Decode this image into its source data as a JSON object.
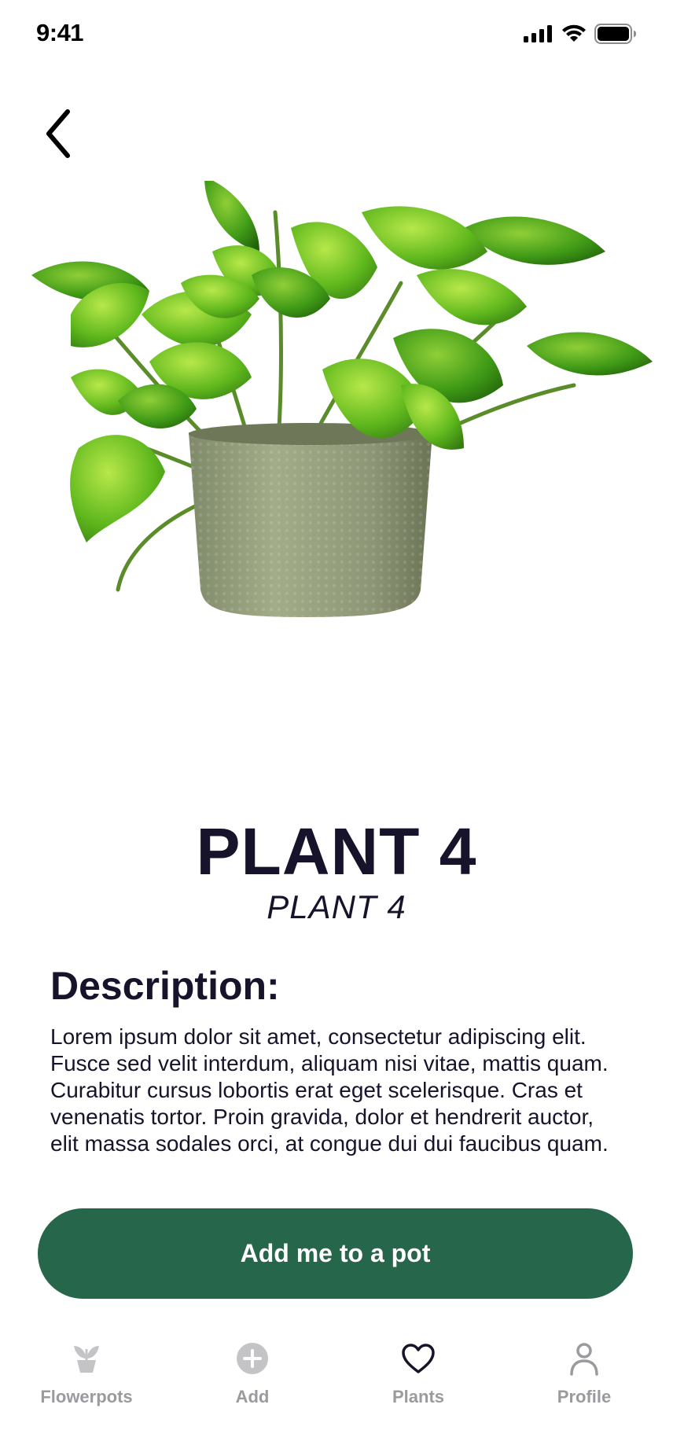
{
  "status_bar": {
    "time": "9:41"
  },
  "header": {
    "back_icon": "chevron-left-icon"
  },
  "plant": {
    "title": "PLANT 4",
    "subtitle": "PLANT 4"
  },
  "description": {
    "heading": "Description:",
    "body": "Lorem ipsum dolor sit amet, consectetur adipiscing elit. Fusce sed velit interdum, aliquam nisi vitae, mattis quam. Curabitur cursus lobortis erat eget scelerisque. Cras et venenatis tortor. Proin gravida, dolor et hendrerit auctor, elit massa sodales orci, at congue dui dui faucibus quam."
  },
  "cta": {
    "label": "Add me to a pot",
    "color": "#26664a"
  },
  "bottom_nav": {
    "items": [
      {
        "label": "Flowerpots",
        "icon": "sprout-pot-icon"
      },
      {
        "label": "Add",
        "icon": "plus-circle-icon"
      },
      {
        "label": "Plants",
        "icon": "heart-icon",
        "active": true
      },
      {
        "label": "Profile",
        "icon": "person-icon"
      }
    ]
  },
  "colors": {
    "text_dark": "#16132b",
    "nav_inactive": "#9a9a9f",
    "nav_active_icon": "#16132b"
  }
}
